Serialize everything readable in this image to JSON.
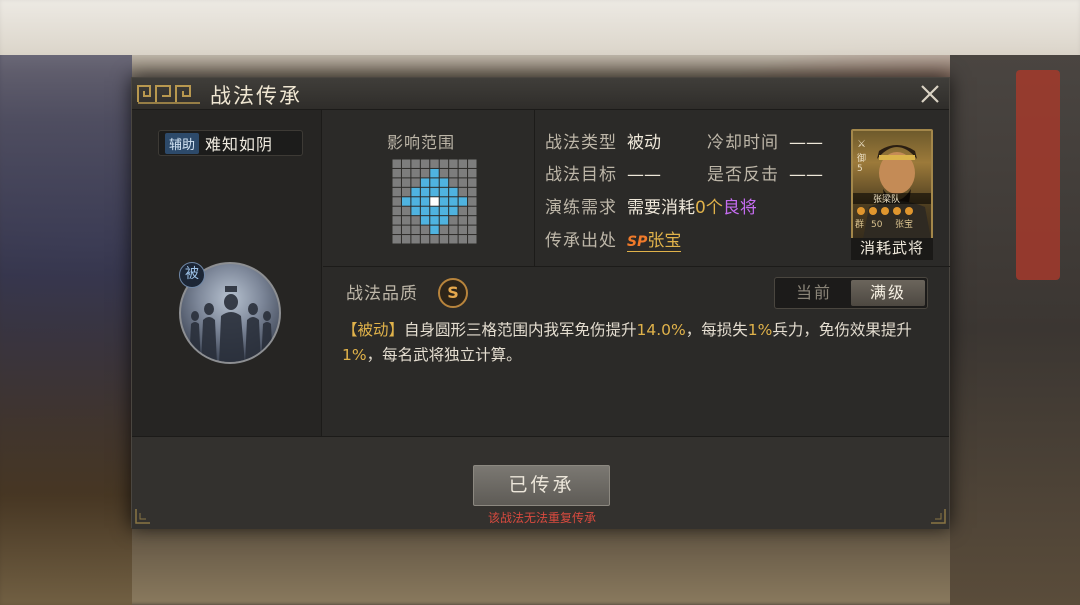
{
  "dialog": {
    "title": "战法传承"
  },
  "skill": {
    "type_tag": "辅助",
    "name": "难知如阴",
    "icon_badge": "被"
  },
  "range": {
    "label": "影响范围"
  },
  "info": {
    "type_label": "战法类型",
    "type_value": "被动",
    "cooldown_label": "冷却时间",
    "cooldown_value": "——",
    "target_label": "战法目标",
    "target_value": "——",
    "counter_label": "是否反击",
    "counter_value": "——",
    "train_label": "演练需求",
    "train_value_prefix": "需要消耗",
    "train_value_count": "0个",
    "train_value_rank": "良将",
    "origin_label": "传承出处",
    "origin_sp": "SP",
    "origin_name": "张宝"
  },
  "portrait": {
    "label": "消耗武将",
    "corner_text": "群",
    "level": "50",
    "name": "张宝",
    "team": "张梁队"
  },
  "quality": {
    "label": "战法品质",
    "grade": "S"
  },
  "toggle": {
    "current": "当前",
    "max": "满级"
  },
  "description": {
    "tag": "【被动】",
    "text1": "自身圆形三格范围内我军免伤提升",
    "value1": "14.0%",
    "text2": "，每损失",
    "value2": "1%",
    "text3": "兵力，免伤效果提升",
    "value3": "1%",
    "text4": "，每名武将独立计算。"
  },
  "footer": {
    "button": "已传承",
    "warning": "该战法无法重复传承"
  },
  "colors": {
    "accent_gold": "#e0b24a",
    "rank_purple": "#c56cf0",
    "warning_red": "#d84a3f",
    "range_blue": "#4fb3e0"
  }
}
